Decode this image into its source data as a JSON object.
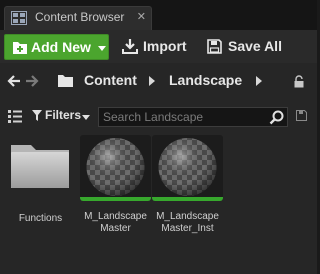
{
  "tab": {
    "title": "Content Browser",
    "close_glyph": "✕",
    "icon": "content-browser-icon"
  },
  "toolbar": {
    "add_new_label": "Add New",
    "import_label": "Import",
    "save_all_label": "Save All"
  },
  "path": {
    "crumbs": [
      "Content",
      "Landscape"
    ]
  },
  "filters": {
    "label": "Filters",
    "search_placeholder": "Search Landscape"
  },
  "assets": [
    {
      "type": "folder",
      "label": "Functions"
    },
    {
      "type": "material",
      "label": "M_Landscape Master"
    },
    {
      "type": "material-instance",
      "label": "M_Landscape Master_Inst"
    }
  ],
  "colors": {
    "accent_green": "#4ba52e",
    "material_strip": "#37a82d",
    "panel_bg": "#262626"
  }
}
